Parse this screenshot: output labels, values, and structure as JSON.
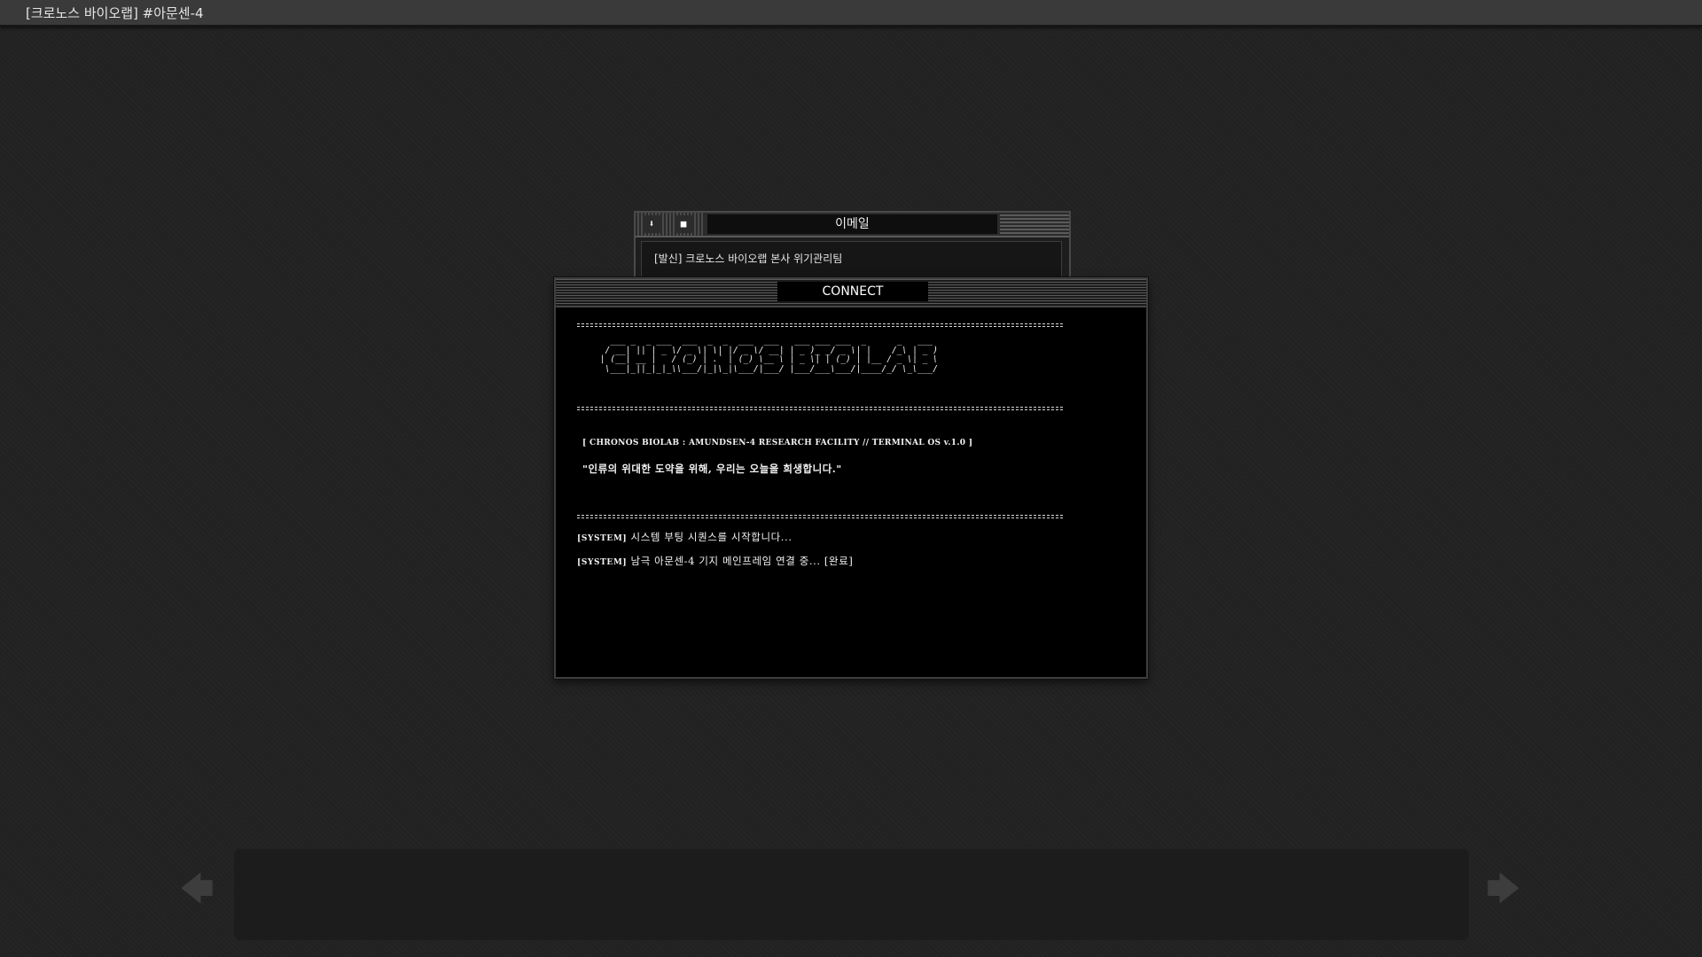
{
  "window": {
    "title": "[크로노스 바이오랩] #아문센-4"
  },
  "email": {
    "title": "이메일",
    "minimize_icon": "download-icon",
    "maximize_icon": "square-icon",
    "sender_line": "[발신] 크로노스 바이오랩 본사 위기관리팀"
  },
  "connect": {
    "title": "CONNECT",
    "ascii_banner": "   ___ _  _ ___  ___  _  _  ___  ___   ___ ___ ___  _      _   ___ \n  / __| || | _ \\/ _ \\| \\| |/ _ \\/ __| | _ )_ _/ _ \\| |    /_\\ | _ )\n | (__| __ |   / (_) | .` | (_) \\__ \\ | _ \\| | (_) | |__ / _ \\| _ \\\n  \\___|_||_|_|_\\\\___/|_|\\_|\\___/|___/ |___/___\\___/|____/_/ \\_\\___/",
    "header_line": "[ CHRONOS BIOLAB : AMUNDSEN-4 RESEARCH FACILITY // TERMINAL OS v.1.0 ]",
    "quote_line": "\"인류의 위대한 도약을 위해, 우리는 오늘을 희생합니다.\"",
    "system_lines": [
      {
        "tag": "[SYSTEM]",
        "text": " 시스템 부팅 시퀀스를 시작합니다..."
      },
      {
        "tag": "[SYSTEM]",
        "text": " 남극 아문센-4 기지 메인프레임 연결 중... [완료]"
      }
    ]
  },
  "nav": {
    "prev_icon": "arrow-left-icon",
    "next_icon": "arrow-right-icon"
  }
}
